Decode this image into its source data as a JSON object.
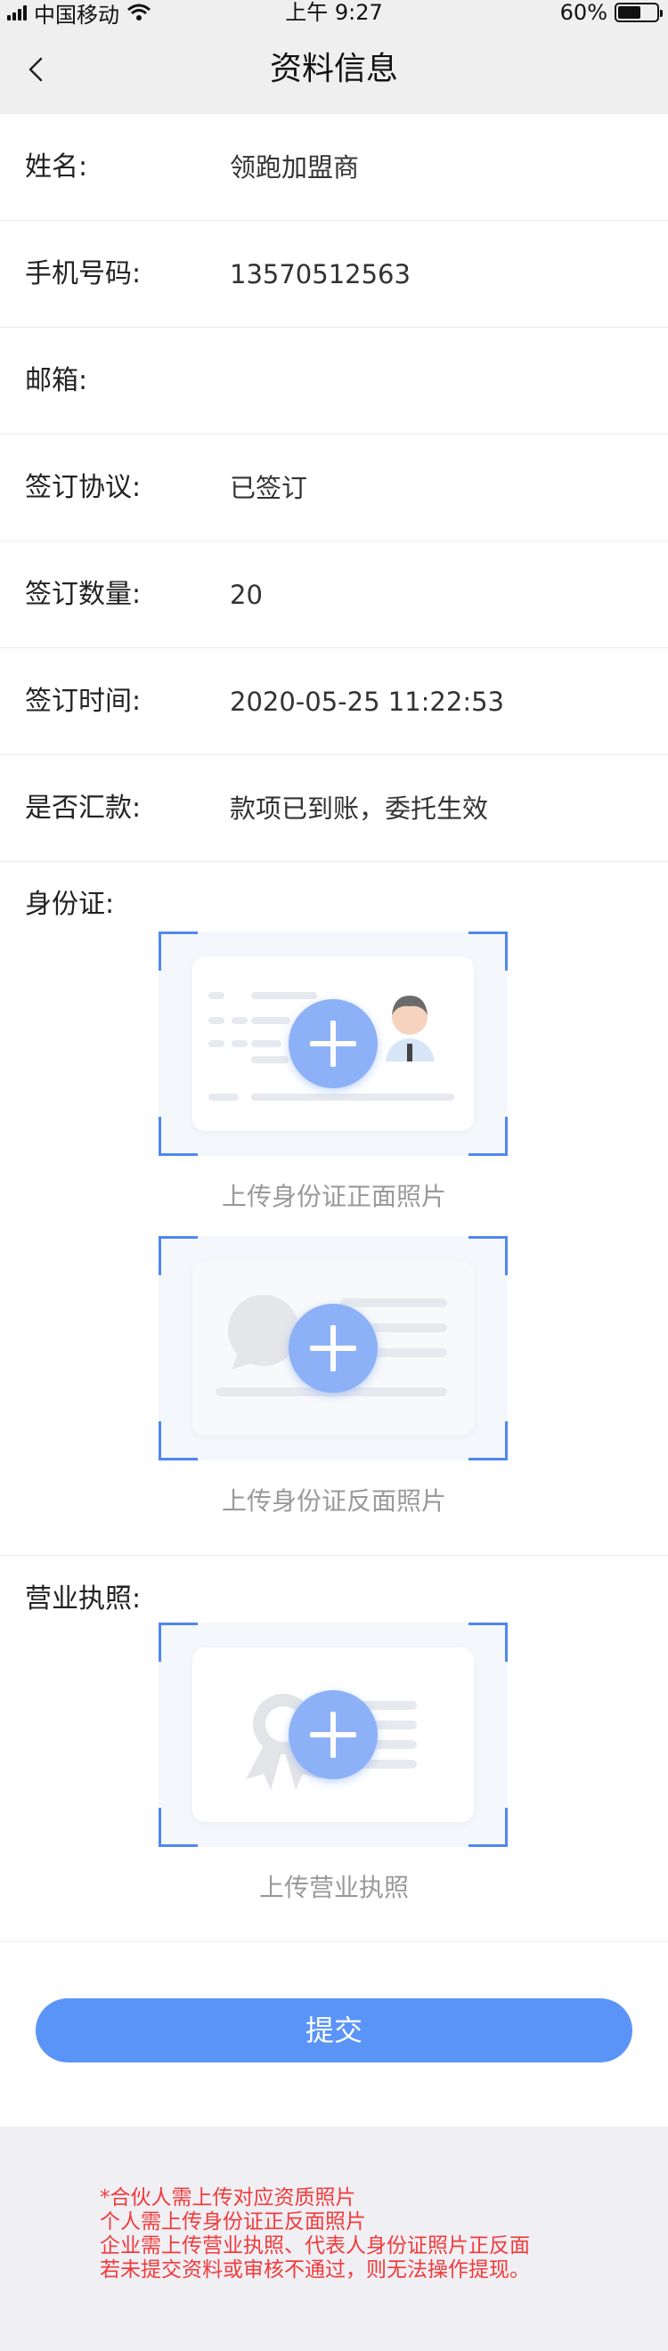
{
  "status_bar": {
    "carrier": "中国移动",
    "time": "上午 9:27",
    "battery_text": "60%",
    "battery_level": 0.6
  },
  "nav": {
    "title": "资料信息"
  },
  "fields": [
    {
      "label": "姓名:",
      "value": "领跑加盟商"
    },
    {
      "label": "手机号码:",
      "value": "13570512563"
    },
    {
      "label": "邮箱:",
      "value": ""
    },
    {
      "label": "签订协议:",
      "value": "已签订"
    },
    {
      "label": "签订数量:",
      "value": "20"
    },
    {
      "label": "签订时间:",
      "value": "2020-05-25 11:22:53"
    },
    {
      "label": "是否汇款:",
      "value": "款项已到账，委托生效"
    }
  ],
  "id_card": {
    "label": "身份证:",
    "front_caption": "上传身份证正面照片",
    "back_caption": "上传身份证反面照片"
  },
  "license": {
    "label": "营业执照:",
    "caption": "上传营业执照"
  },
  "submit_label": "提交",
  "notes": [
    "*合伙人需上传对应资质照片",
    "个人需上传身份证正反面照片",
    "企业需上传营业执照、代表人身份证照片正反面",
    "若未提交资料或审核不通过，则无法操作提现。"
  ],
  "colors": {
    "accent": "#5b94f7",
    "corner": "#4f88f0",
    "note": "#f23a3a"
  }
}
